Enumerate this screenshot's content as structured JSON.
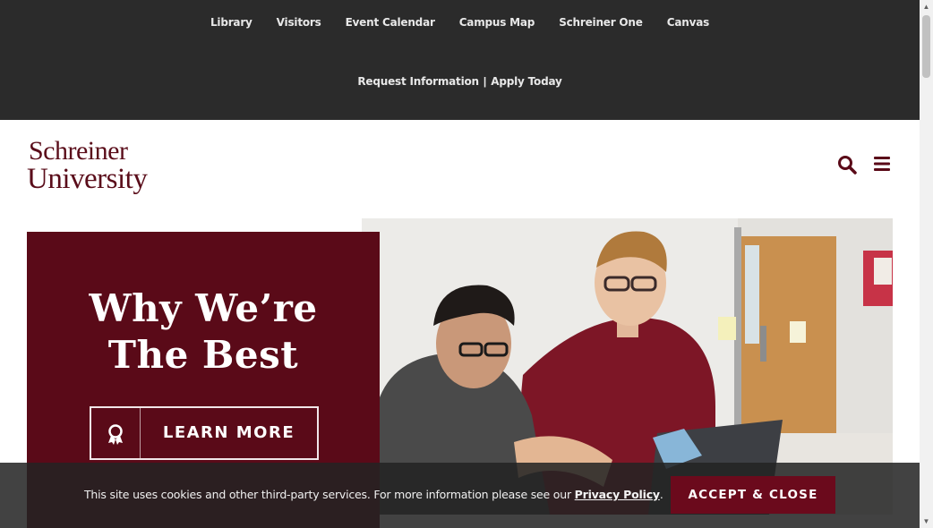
{
  "topnav": {
    "items": [
      {
        "label": "Library"
      },
      {
        "label": "Visitors"
      },
      {
        "label": "Event Calendar"
      },
      {
        "label": "Campus Map"
      },
      {
        "label": "Schreiner One"
      },
      {
        "label": "Canvas"
      }
    ],
    "request_info": "Request Information",
    "separator": "|",
    "apply_today": "Apply Today"
  },
  "logo": {
    "line1": "Schreiner",
    "line2": "University"
  },
  "header": {
    "search_icon": "search-icon",
    "menu_icon": "hamburger-menu-icon"
  },
  "hero": {
    "title_line1": "Why We’re",
    "title_line2": "The Best",
    "button_label": "LEARN MORE",
    "button_icon": "award-ribbon-icon"
  },
  "cookie_banner": {
    "text": "This site uses cookies and other third-party services. For more information please see our",
    "link_label": "Privacy Policy",
    "text_end": ".",
    "accept_label": "ACCEPT & CLOSE"
  },
  "colors": {
    "brand_maroon": "#5a0a18",
    "topbar_bg": "#2b2b2b",
    "accept_bg": "#6b0a1c"
  }
}
